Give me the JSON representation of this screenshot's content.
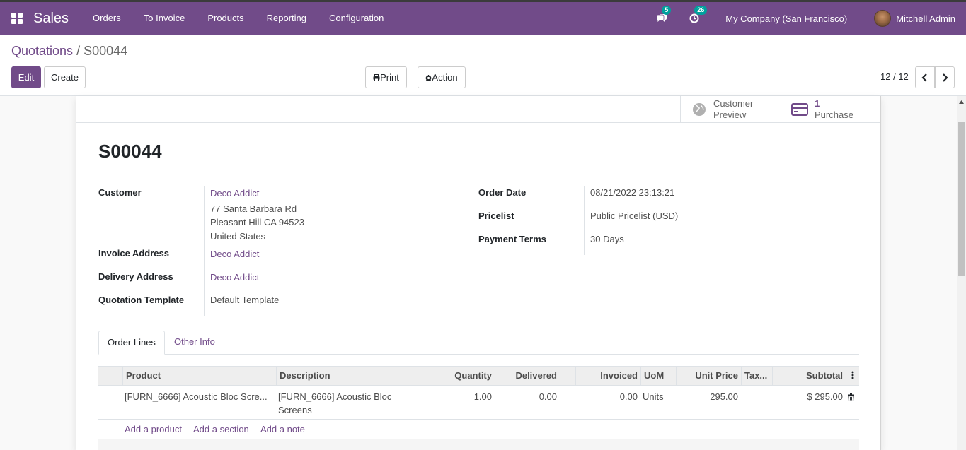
{
  "navbar": {
    "app_name": "Sales",
    "menu": [
      "Orders",
      "To Invoice",
      "Products",
      "Reporting",
      "Configuration"
    ],
    "messages_count": "5",
    "activities_count": "26",
    "company": "My Company (San Francisco)",
    "user": "Mitchell Admin",
    "icons": [
      "apps-grid-icon",
      "chat-icon",
      "clock-icon",
      "avatar"
    ]
  },
  "breadcrumb": {
    "parent": "Quotations",
    "separator": "/",
    "current": "S00044"
  },
  "buttons": {
    "edit": "Edit",
    "create": "Create",
    "print": "Print",
    "action": "Action"
  },
  "pager": {
    "value": "12 / 12"
  },
  "smart_buttons": {
    "customer_preview_line1": "Customer",
    "customer_preview_line2": "Preview",
    "purchase_count": "1",
    "purchase_label": "Purchase"
  },
  "record": {
    "name": "S00044",
    "customer_label": "Customer",
    "customer_name": "Deco Addict",
    "customer_address": [
      "77 Santa Barbara Rd",
      "Pleasant Hill CA 94523",
      "United States"
    ],
    "invoice_address_label": "Invoice Address",
    "invoice_address": "Deco Addict",
    "delivery_address_label": "Delivery Address",
    "delivery_address": "Deco Addict",
    "quotation_template_label": "Quotation Template",
    "quotation_template": "Default Template",
    "order_date_label": "Order Date",
    "order_date": "08/21/2022 23:13:21",
    "pricelist_label": "Pricelist",
    "pricelist": "Public Pricelist (USD)",
    "payment_terms_label": "Payment Terms",
    "payment_terms": "30 Days"
  },
  "tabs": [
    "Order Lines",
    "Other Info"
  ],
  "order_lines": {
    "columns": [
      "Product",
      "Description",
      "Quantity",
      "Delivered",
      "Invoiced",
      "UoM",
      "Unit Price",
      "Tax...",
      "Subtotal"
    ],
    "rows": [
      {
        "product": "[FURN_6666] Acoustic Bloc Scre...",
        "description_line1": "[FURN_6666] Acoustic Bloc",
        "description_line2": "Screens",
        "quantity": "1.00",
        "delivered": "0.00",
        "invoiced": "0.00",
        "uom": "Units",
        "unit_price": "295.00",
        "taxes": "",
        "subtotal": "$ 295.00"
      }
    ],
    "add_product": "Add a product",
    "add_section": "Add a section",
    "add_note": "Add a note"
  },
  "colors": {
    "brand": "#714b89",
    "badge": "#00a09d"
  }
}
